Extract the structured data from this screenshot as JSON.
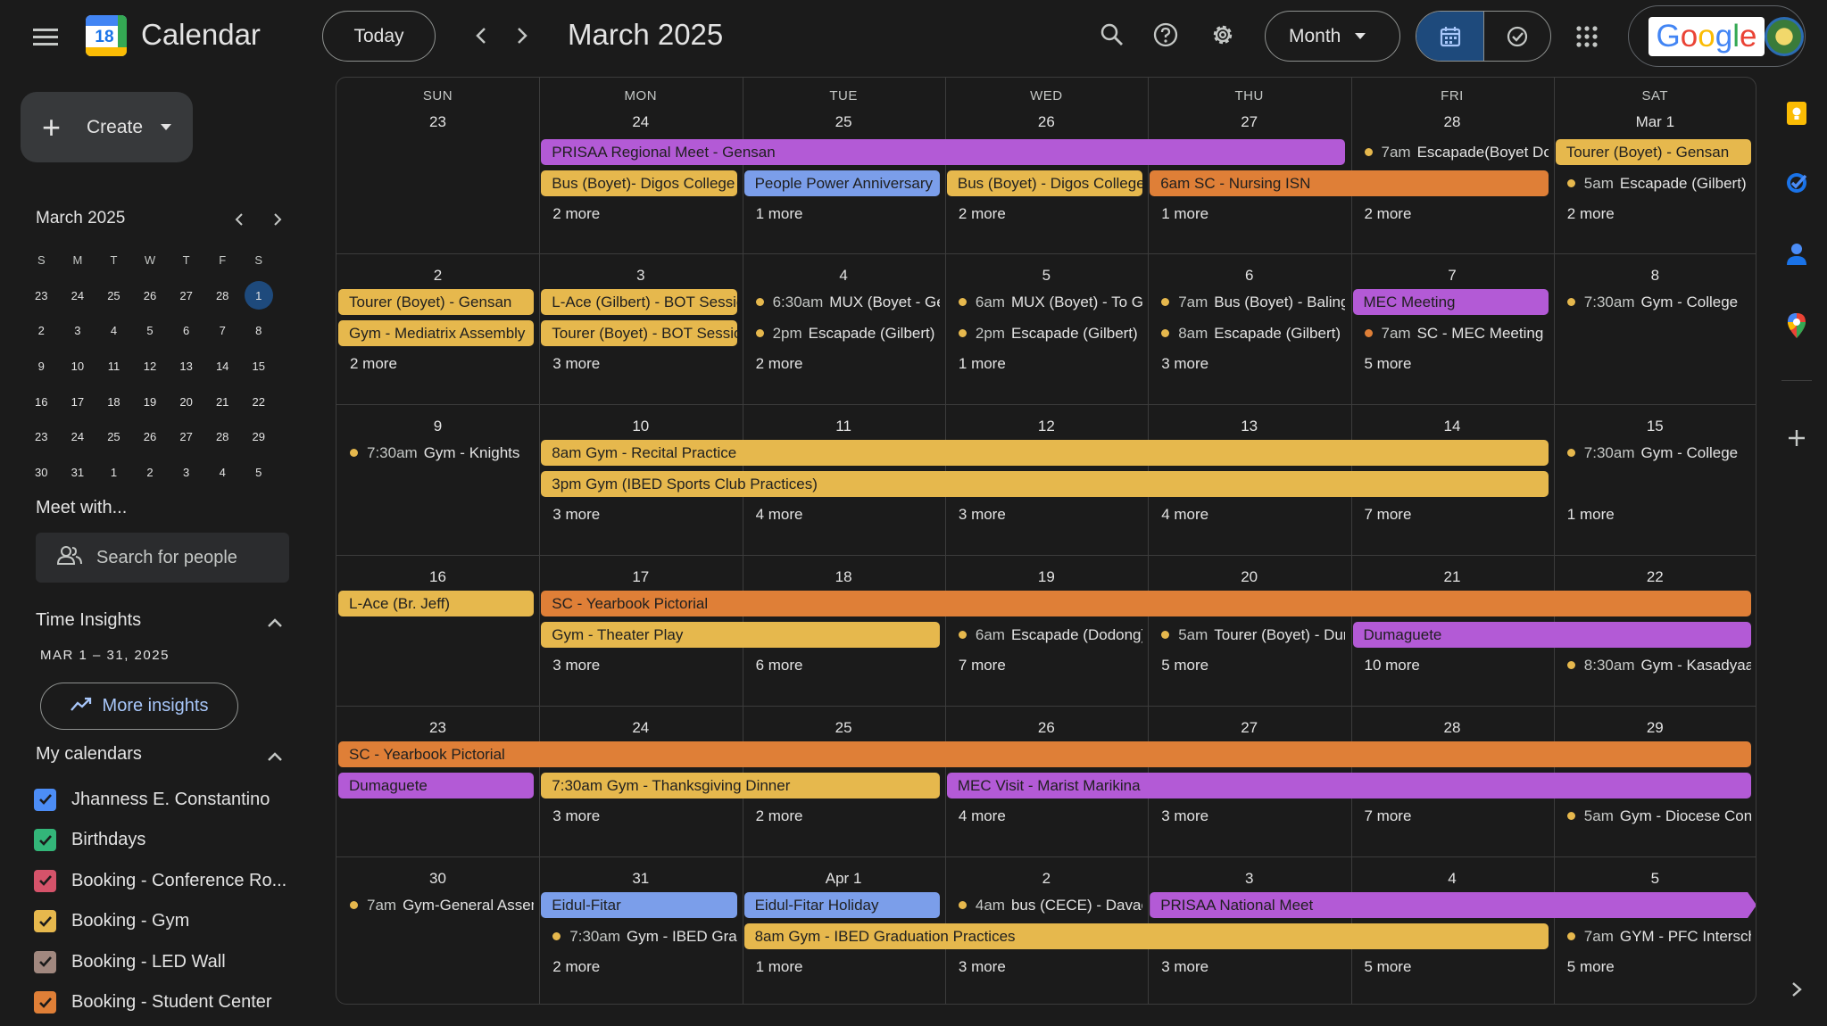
{
  "header": {
    "app_name": "Calendar",
    "logo_day": "18",
    "today_label": "Today",
    "month_title": "March 2025",
    "view_label": "Month",
    "google_label": "Google"
  },
  "sidebar": {
    "create_label": "Create",
    "mini_cal": {
      "title": "March 2025",
      "days": [
        "S",
        "M",
        "T",
        "W",
        "T",
        "F",
        "S"
      ],
      "weeks": [
        [
          "23",
          "24",
          "25",
          "26",
          "27",
          "28",
          "1"
        ],
        [
          "2",
          "3",
          "4",
          "5",
          "6",
          "7",
          "8"
        ],
        [
          "9",
          "10",
          "11",
          "12",
          "13",
          "14",
          "15"
        ],
        [
          "16",
          "17",
          "18",
          "19",
          "20",
          "21",
          "22"
        ],
        [
          "23",
          "24",
          "25",
          "26",
          "27",
          "28",
          "29"
        ],
        [
          "30",
          "31",
          "1",
          "2",
          "3",
          "4",
          "5"
        ]
      ]
    },
    "meet_with": "Meet with...",
    "search_people_placeholder": "Search for people",
    "time_insights": "Time Insights",
    "insights_range": "MAR 1 – 31, 2025",
    "more_insights": "More insights",
    "my_calendars": "My calendars",
    "calendars": [
      {
        "name": "Jhanness E. Constantino",
        "color": "#4c8df6"
      },
      {
        "name": "Birthdays",
        "color": "#33b679"
      },
      {
        "name": "Booking - Conference Ro...",
        "color": "#d5536a"
      },
      {
        "name": "Booking - Gym",
        "color": "#e6b84d"
      },
      {
        "name": "Booking - LED Wall",
        "color": "#a1887f"
      },
      {
        "name": "Booking - Student Center",
        "color": "#df7f37"
      }
    ]
  },
  "grid": {
    "dow": [
      "SUN",
      "MON",
      "TUE",
      "WED",
      "THU",
      "FRI",
      "SAT"
    ],
    "weeks": [
      {
        "days": [
          "23",
          "24",
          "25",
          "26",
          "27",
          "28",
          "Mar 1"
        ],
        "bars": [
          {
            "col": 1,
            "span": 4,
            "color": "purple",
            "label": "PRISAA Regional Meet - Gensan"
          },
          {
            "col": 6,
            "span": 1,
            "color": "yellow",
            "label": "Tourer (Boyet) - Gensan"
          },
          {
            "col": 1,
            "span": 1,
            "row": 1,
            "color": "yellow",
            "label": "Bus (Boyet)- Digos College"
          },
          {
            "col": 2,
            "span": 1,
            "row": 1,
            "color": "blue",
            "label": "People Power Anniversary"
          },
          {
            "col": 3,
            "span": 1,
            "row": 1,
            "color": "yellow",
            "label": "Bus (Boyet) - Digos College"
          },
          {
            "col": 4,
            "span": 2,
            "row": 1,
            "color": "orange",
            "label": "6am SC - Nursing ISN"
          }
        ],
        "dots": [
          {
            "col": 5,
            "row": 0,
            "time": "7am",
            "label": "Escapade(Boyet Dodong)",
            "color": "#e6b84d"
          },
          {
            "col": 6,
            "row": 1,
            "time": "5am",
            "label": "Escapade (Gilbert)",
            "color": "#e6b84d"
          }
        ],
        "more": [
          "",
          "2 more",
          "1 more",
          "2 more",
          "1 more",
          "2 more",
          "2 more"
        ]
      },
      {
        "days": [
          "2",
          "3",
          "4",
          "5",
          "6",
          "7",
          "8"
        ],
        "bars": [
          {
            "col": 0,
            "span": 1,
            "row": 0,
            "color": "yellow",
            "label": "Tourer (Boyet) - Gensan"
          },
          {
            "col": 0,
            "span": 1,
            "row": 1,
            "color": "yellow",
            "label": "Gym - Mediatrix Assembly"
          },
          {
            "col": 1,
            "span": 1,
            "row": 0,
            "color": "yellow",
            "label": "L-Ace (Gilbert) - BOT Session"
          },
          {
            "col": 1,
            "span": 1,
            "row": 1,
            "color": "yellow",
            "label": "Tourer (Boyet) - BOT Session"
          },
          {
            "col": 5,
            "span": 1,
            "row": 0,
            "color": "purple",
            "label": "MEC Meeting"
          }
        ],
        "dots": [
          {
            "col": 2,
            "row": 0,
            "time": "6:30am",
            "label": "MUX (Boyet - Gensan)",
            "color": "#e6b84d"
          },
          {
            "col": 2,
            "row": 1,
            "time": "2pm",
            "label": "Escapade (Gilbert)",
            "color": "#e6b84d"
          },
          {
            "col": 3,
            "row": 0,
            "time": "6am",
            "label": "MUX (Boyet) - To Gensan",
            "color": "#e6b84d"
          },
          {
            "col": 3,
            "row": 1,
            "time": "2pm",
            "label": "Escapade (Gilbert)",
            "color": "#e6b84d"
          },
          {
            "col": 4,
            "row": 0,
            "time": "7am",
            "label": "Bus (Boyet) - Balingasag",
            "color": "#e6b84d"
          },
          {
            "col": 4,
            "row": 1,
            "time": "8am",
            "label": "Escapade (Gilbert)",
            "color": "#e6b84d"
          },
          {
            "col": 5,
            "row": 1,
            "time": "7am",
            "label": "SC - MEC Meeting",
            "color": "#df7f37"
          },
          {
            "col": 6,
            "row": 0,
            "time": "7:30am",
            "label": "Gym - College",
            "color": "#e6b84d"
          }
        ],
        "more": [
          "2 more",
          "3 more",
          "2 more",
          "1 more",
          "3 more",
          "5 more",
          ""
        ]
      },
      {
        "days": [
          "9",
          "10",
          "11",
          "12",
          "13",
          "14",
          "15"
        ],
        "bars": [
          {
            "col": 1,
            "span": 5,
            "row": 0,
            "color": "yellow",
            "label": "8am Gym - Recital Practice"
          },
          {
            "col": 1,
            "span": 5,
            "row": 1,
            "color": "yellow",
            "label": "3pm Gym (IBED Sports Club Practices)"
          }
        ],
        "dots": [
          {
            "col": 0,
            "row": 0,
            "time": "7:30am",
            "label": "Gym - Knights",
            "color": "#e6b84d"
          },
          {
            "col": 6,
            "row": 0,
            "time": "7:30am",
            "label": "Gym - College",
            "color": "#e6b84d"
          }
        ],
        "more": [
          "",
          "3 more",
          "4 more",
          "3 more",
          "4 more",
          "7 more",
          "1 more"
        ]
      },
      {
        "days": [
          "16",
          "17",
          "18",
          "19",
          "20",
          "21",
          "22"
        ],
        "bars": [
          {
            "col": 0,
            "span": 1,
            "row": 0,
            "color": "yellow",
            "label": "L-Ace (Br. Jeff)"
          },
          {
            "col": 1,
            "span": 6,
            "row": 0,
            "color": "orange",
            "label": "SC - Yearbook Pictorial"
          },
          {
            "col": 1,
            "span": 2,
            "row": 1,
            "color": "yellow",
            "label": "Gym - Theater Play"
          },
          {
            "col": 5,
            "span": 2,
            "row": 1,
            "color": "purple",
            "label": "Dumaguete"
          }
        ],
        "dots": [
          {
            "col": 3,
            "row": 1,
            "time": "6am",
            "label": "Escapade (Dodong)",
            "color": "#e6b84d"
          },
          {
            "col": 4,
            "row": 1,
            "time": "5am",
            "label": "Tourer (Boyet) - Dumaguete",
            "color": "#e6b84d"
          },
          {
            "col": 6,
            "row": 2,
            "time": "8:30am",
            "label": "Gym - Kasadyaan",
            "color": "#e6b84d"
          }
        ],
        "more": [
          "",
          "3 more",
          "6 more",
          "7 more",
          "5 more",
          "10 more",
          ""
        ]
      },
      {
        "days": [
          "23",
          "24",
          "25",
          "26",
          "27",
          "28",
          "29"
        ],
        "bars": [
          {
            "col": 0,
            "span": 7,
            "row": 0,
            "color": "orange",
            "label": "SC - Yearbook Pictorial"
          },
          {
            "col": 0,
            "span": 1,
            "row": 1,
            "color": "purple",
            "label": "Dumaguete"
          },
          {
            "col": 1,
            "span": 2,
            "row": 1,
            "color": "yellow",
            "label": "7:30am Gym - Thanksgiving Dinner"
          },
          {
            "col": 3,
            "span": 4,
            "row": 1,
            "color": "purple",
            "label": "MEC Visit - Marist Marikina"
          }
        ],
        "dots": [
          {
            "col": 6,
            "row": 2,
            "time": "5am",
            "label": "Gym - Diocese Congress",
            "color": "#e6b84d"
          }
        ],
        "more": [
          "",
          "3 more",
          "2 more",
          "4 more",
          "3 more",
          "7 more",
          ""
        ]
      },
      {
        "days": [
          "30",
          "31",
          "Apr 1",
          "2",
          "3",
          "4",
          "5"
        ],
        "bars": [
          {
            "col": 1,
            "span": 1,
            "row": 0,
            "color": "blue",
            "label": "Eidul-Fitar"
          },
          {
            "col": 2,
            "span": 1,
            "row": 0,
            "color": "blue",
            "label": "Eidul-Fitar Holiday"
          },
          {
            "col": 4,
            "span": 3,
            "row": 0,
            "color": "purple",
            "label": "PRISAA National Meet",
            "arrow": true
          },
          {
            "col": 2,
            "span": 4,
            "row": 1,
            "color": "yellow",
            "label": "8am Gym - IBED Graduation Practices"
          }
        ],
        "dots": [
          {
            "col": 0,
            "row": 0,
            "time": "7am",
            "label": "Gym-General Assembly",
            "color": "#e6b84d"
          },
          {
            "col": 1,
            "row": 1,
            "time": "7:30am",
            "label": "Gym - IBED Graduation",
            "color": "#e6b84d"
          },
          {
            "col": 3,
            "row": 0,
            "time": "4am",
            "label": "bus (CECE) - Davao",
            "color": "#e6b84d"
          },
          {
            "col": 6,
            "row": 1,
            "time": "7am",
            "label": "GYM - PFC Intersch",
            "color": "#e6b84d"
          }
        ],
        "more": [
          "",
          "2 more",
          "1 more",
          "3 more",
          "3 more",
          "5 more",
          "5 more"
        ]
      }
    ]
  },
  "colors": {
    "accent": "#a8c7fa",
    "background": "#1b1b1b",
    "selected": "#1e4a7c"
  }
}
